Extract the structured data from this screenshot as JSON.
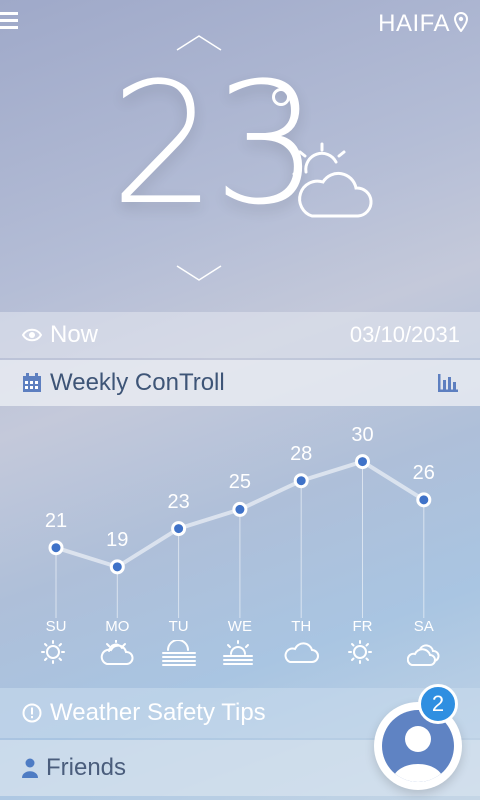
{
  "header": {
    "city": "HAIFA",
    "menu_icon": "hamburger-menu-icon",
    "location_icon": "map-pin-icon"
  },
  "current": {
    "temperature": "23",
    "condition_icon": "partly-cloudy-icon"
  },
  "now_bar": {
    "label": "Now",
    "date": "03/10/2031",
    "icon": "eye-icon"
  },
  "weekly_bar": {
    "label": "Weekly ConTroll",
    "icon": "calendar-icon",
    "action_icon": "bar-chart-icon"
  },
  "chart_data": {
    "type": "line",
    "categories": [
      "SU",
      "MO",
      "TU",
      "WE",
      "TH",
      "FR",
      "SA"
    ],
    "values": [
      21,
      19,
      23,
      25,
      28,
      30,
      26
    ],
    "icons": [
      "sun-icon",
      "partly-cloudy-icon",
      "fog-icon",
      "sunrise-icon",
      "cloud-icon",
      "sun-icon",
      "clouds-icon"
    ],
    "ylim": [
      17,
      31
    ]
  },
  "tips_bar": {
    "label": "Weather Safety Tips",
    "icon": "alert-circle-icon"
  },
  "friends_bar": {
    "label": "Friends",
    "icon": "person-icon"
  },
  "notification": {
    "count": "2"
  },
  "colors": {
    "accent": "#2f8fe1",
    "avatar": "#5f83c3",
    "weekly_text": "#3e5577"
  }
}
